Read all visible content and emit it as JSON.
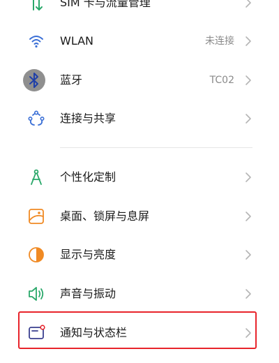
{
  "settings": {
    "items": [
      {
        "label": "SIM 卡与流量管理",
        "value": "",
        "icon": "sim-traffic-icon"
      },
      {
        "label": "WLAN",
        "value": "未连接",
        "icon": "wifi-icon"
      },
      {
        "label": "蓝牙",
        "value": "TC02",
        "icon": "bluetooth-icon"
      },
      {
        "label": "连接与共享",
        "value": "",
        "icon": "connection-share-icon"
      },
      {
        "label": "个性化定制",
        "value": "",
        "icon": "personalization-icon"
      },
      {
        "label": "桌面、锁屏与息屏",
        "value": "",
        "icon": "desktop-lockscreen-icon"
      },
      {
        "label": "显示与亮度",
        "value": "",
        "icon": "display-brightness-icon"
      },
      {
        "label": "声音与振动",
        "value": "",
        "icon": "sound-vibration-icon"
      },
      {
        "label": "通知与状态栏",
        "value": "",
        "icon": "notification-statusbar-icon"
      }
    ]
  },
  "colors": {
    "icon_green": "#2aa86a",
    "icon_blue": "#3a6fd6",
    "icon_orange": "#f08a24",
    "highlight_red": "#e8242b"
  }
}
